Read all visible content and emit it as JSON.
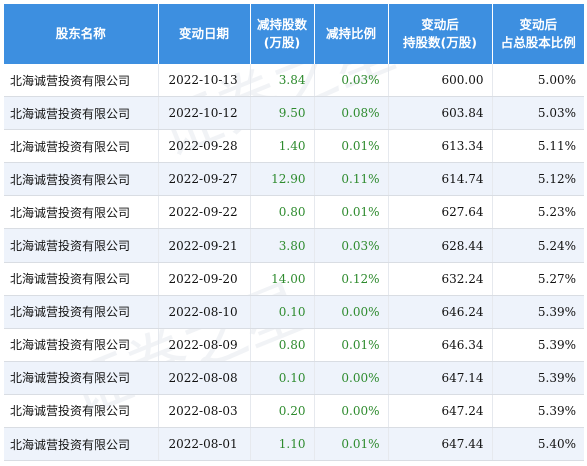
{
  "table": {
    "headers": [
      {
        "line1": "股东名称",
        "line2": ""
      },
      {
        "line1": "变动日期",
        "line2": ""
      },
      {
        "line1": "减持股数",
        "line2": "(万股)"
      },
      {
        "line1": "减持比例",
        "line2": ""
      },
      {
        "line1": "变动后",
        "line2": "持股数(万股)"
      },
      {
        "line1": "变动后",
        "line2": "占总股本比例"
      }
    ],
    "rows": [
      [
        "北海诚营投资有限公司",
        "2022-10-13",
        "3.84",
        "0.03%",
        "600.00",
        "5.00%"
      ],
      [
        "北海诚营投资有限公司",
        "2022-10-12",
        "9.50",
        "0.08%",
        "603.84",
        "5.03%"
      ],
      [
        "北海诚营投资有限公司",
        "2022-09-28",
        "1.40",
        "0.01%",
        "613.34",
        "5.11%"
      ],
      [
        "北海诚营投资有限公司",
        "2022-09-27",
        "12.90",
        "0.11%",
        "614.74",
        "5.12%"
      ],
      [
        "北海诚营投资有限公司",
        "2022-09-22",
        "0.80",
        "0.01%",
        "627.64",
        "5.23%"
      ],
      [
        "北海诚营投资有限公司",
        "2022-09-21",
        "3.80",
        "0.03%",
        "628.44",
        "5.24%"
      ],
      [
        "北海诚营投资有限公司",
        "2022-09-20",
        "14.00",
        "0.12%",
        "632.24",
        "5.27%"
      ],
      [
        "北海诚营投资有限公司",
        "2022-08-10",
        "0.10",
        "0.00%",
        "646.24",
        "5.39%"
      ],
      [
        "北海诚营投资有限公司",
        "2022-08-09",
        "0.80",
        "0.01%",
        "646.34",
        "5.39%"
      ],
      [
        "北海诚营投资有限公司",
        "2022-08-08",
        "0.10",
        "0.00%",
        "647.14",
        "5.39%"
      ],
      [
        "北海诚营投资有限公司",
        "2022-08-03",
        "0.20",
        "0.00%",
        "647.24",
        "5.39%"
      ],
      [
        "北海诚营投资有限公司",
        "2022-08-01",
        "1.10",
        "0.01%",
        "647.44",
        "5.40%"
      ]
    ]
  },
  "colors": {
    "header_bg": "#3d8fe0",
    "header_text": "#ffffff",
    "reduction_text": "#2e8b2e",
    "alt_row_bg": "#eef3fb"
  }
}
